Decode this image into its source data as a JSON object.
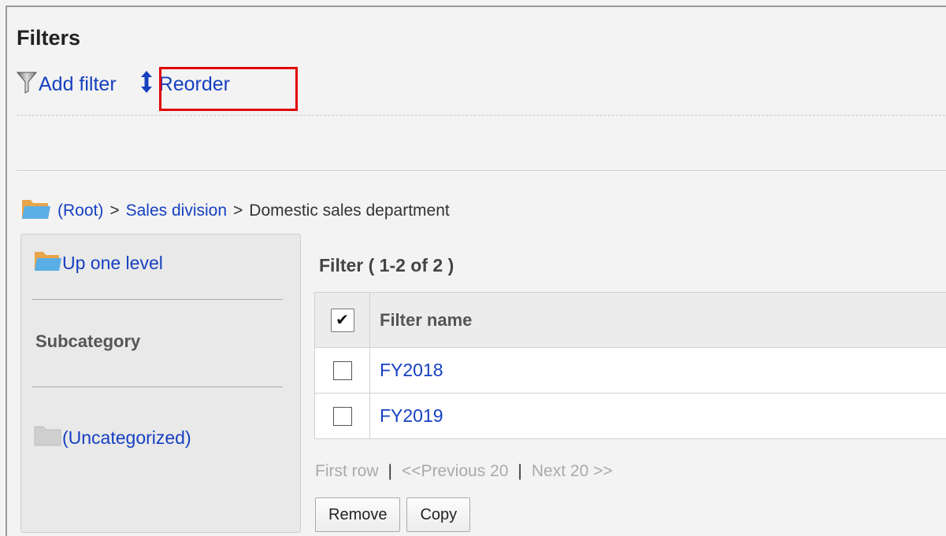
{
  "page_title": "Filters",
  "toolbar": {
    "add_filter": "Add filter",
    "reorder": "Reorder"
  },
  "breadcrumb": {
    "root": "(Root)",
    "separator": ">",
    "level1": "Sales division",
    "current": "Domestic sales department"
  },
  "sidebar": {
    "up_one_level": "Up one level",
    "subcategory_heading": "Subcategory",
    "uncategorized": "(Uncategorized)"
  },
  "list": {
    "heading": "Filter ( 1-2 of 2 )",
    "check_all_glyph": "✔",
    "column_name": "Filter name",
    "rows": [
      {
        "name": "FY2018"
      },
      {
        "name": "FY2019"
      }
    ]
  },
  "pager": {
    "first": "First row",
    "previous": "<<Previous 20",
    "next": "Next 20 >>",
    "bar": "|"
  },
  "buttons": {
    "remove": "Remove",
    "copy": "Copy"
  },
  "colors": {
    "link": "#1540c0",
    "highlight": "#e00000",
    "folder_blue": "#5aaee6",
    "folder_orange": "#e8a54a"
  }
}
